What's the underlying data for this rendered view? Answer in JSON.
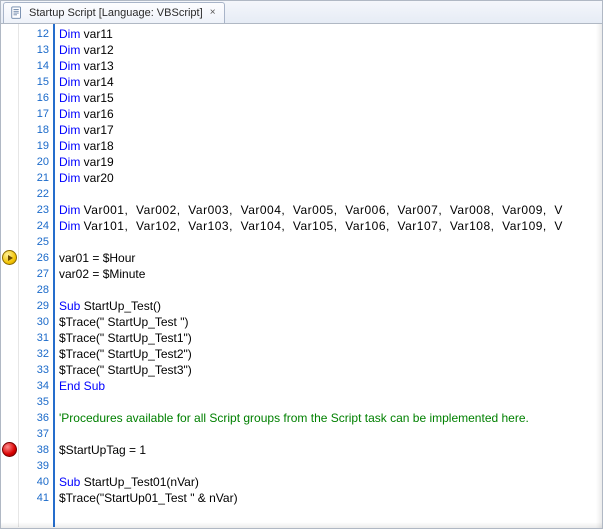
{
  "tab": {
    "iconName": "document-icon",
    "title": "Startup Script [Language: VBScript]",
    "closeGlyph": "×"
  },
  "markers": [
    {
      "type": "exec",
      "line": 26
    },
    {
      "type": "bp",
      "line": 38
    }
  ],
  "firstLineNumber": 12,
  "lines": [
    [
      {
        "cls": "kw",
        "t": "Dim "
      },
      {
        "cls": "var",
        "t": "var11"
      }
    ],
    [
      {
        "cls": "kw",
        "t": "Dim "
      },
      {
        "cls": "var",
        "t": "var12"
      }
    ],
    [
      {
        "cls": "kw",
        "t": "Dim "
      },
      {
        "cls": "var",
        "t": "var13"
      }
    ],
    [
      {
        "cls": "kw",
        "t": "Dim "
      },
      {
        "cls": "var",
        "t": "var14"
      }
    ],
    [
      {
        "cls": "kw",
        "t": "Dim "
      },
      {
        "cls": "var",
        "t": "var15"
      }
    ],
    [
      {
        "cls": "kw",
        "t": "Dim "
      },
      {
        "cls": "var",
        "t": "var16"
      }
    ],
    [
      {
        "cls": "kw",
        "t": "Dim "
      },
      {
        "cls": "var",
        "t": "var17"
      }
    ],
    [
      {
        "cls": "kw",
        "t": "Dim "
      },
      {
        "cls": "var",
        "t": "var18"
      }
    ],
    [
      {
        "cls": "kw",
        "t": "Dim "
      },
      {
        "cls": "var",
        "t": "var19"
      }
    ],
    [
      {
        "cls": "kw",
        "t": "Dim "
      },
      {
        "cls": "var",
        "t": "var20"
      }
    ],
    [
      {
        "cls": "var",
        "t": ""
      }
    ],
    [
      {
        "cls": "kw",
        "t": "Dim "
      },
      {
        "cls": "var sep",
        "t": "Var001,  Var002,  Var003,  Var004,  Var005,  Var006,  Var007,  Var008,  Var009,  V"
      }
    ],
    [
      {
        "cls": "kw",
        "t": "Dim "
      },
      {
        "cls": "var sep",
        "t": "Var101,  Var102,  Var103,  Var104,  Var105,  Var106,  Var107,  Var108,  Var109,  V"
      }
    ],
    [
      {
        "cls": "var",
        "t": ""
      }
    ],
    [
      {
        "cls": "var",
        "t": "var01 = $Hour"
      }
    ],
    [
      {
        "cls": "var",
        "t": "var02 = $Minute"
      }
    ],
    [
      {
        "cls": "var",
        "t": ""
      }
    ],
    [
      {
        "cls": "kw",
        "t": "Sub "
      },
      {
        "cls": "var",
        "t": "StartUp_Test()"
      }
    ],
    [
      {
        "cls": "var",
        "t": "$Trace(\" StartUp_Test \")"
      }
    ],
    [
      {
        "cls": "var",
        "t": "$Trace(\" StartUp_Test1\")"
      }
    ],
    [
      {
        "cls": "var",
        "t": "$Trace(\" StartUp_Test2\")"
      }
    ],
    [
      {
        "cls": "var",
        "t": "$Trace(\" StartUp_Test3\")"
      }
    ],
    [
      {
        "cls": "kw",
        "t": "End Sub"
      }
    ],
    [
      {
        "cls": "var",
        "t": ""
      }
    ],
    [
      {
        "cls": "cmt",
        "t": "'Procedures available for all Script groups from the Script task can be implemented here."
      }
    ],
    [
      {
        "cls": "var",
        "t": ""
      }
    ],
    [
      {
        "cls": "var",
        "t": "$StartUpTag = 1"
      }
    ],
    [
      {
        "cls": "var",
        "t": ""
      }
    ],
    [
      {
        "cls": "kw",
        "t": "Sub "
      },
      {
        "cls": "var",
        "t": "StartUp_Test01(nVar)"
      }
    ],
    [
      {
        "cls": "var",
        "t": "$Trace(\"StartUp01_Test \" & nVar)"
      }
    ]
  ]
}
